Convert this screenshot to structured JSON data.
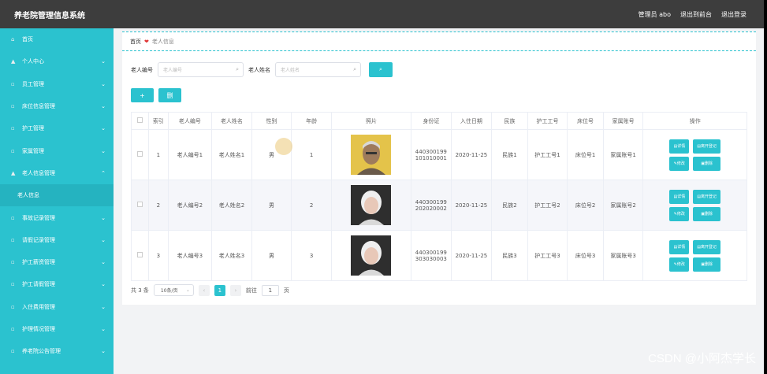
{
  "app": {
    "title": "养老院管理信息系统"
  },
  "topbar": {
    "admin": "管理员 abo",
    "back": "退出到前台",
    "logout": "退出登录"
  },
  "sidebar": {
    "items": [
      {
        "label": "首页",
        "arrow": ""
      },
      {
        "label": "个人中心",
        "arrow": "⌄"
      },
      {
        "label": "员工管理",
        "arrow": "⌄"
      },
      {
        "label": "床位信息管理",
        "arrow": "⌄"
      },
      {
        "label": "护工管理",
        "arrow": "⌄"
      },
      {
        "label": "家属管理",
        "arrow": "⌄"
      },
      {
        "label": "老人信息管理",
        "arrow": "⌃"
      },
      {
        "label": "老人信息",
        "arrow": ""
      },
      {
        "label": "事故记录管理",
        "arrow": "⌄"
      },
      {
        "label": "请假记录管理",
        "arrow": "⌄"
      },
      {
        "label": "护工薪资管理",
        "arrow": "⌄"
      },
      {
        "label": "护工请假管理",
        "arrow": "⌄"
      },
      {
        "label": "入住费用管理",
        "arrow": "⌄"
      },
      {
        "label": "护理情况管理",
        "arrow": "⌄"
      },
      {
        "label": "养老院公告管理",
        "arrow": "⌄"
      }
    ]
  },
  "breadcrumb": {
    "home": "首页",
    "heart": "❤",
    "current": "老人信息"
  },
  "search": {
    "id_label": "老人编号",
    "id_placeholder": "老人编号",
    "name_label": "老人姓名",
    "name_placeholder": "老人姓名"
  },
  "ops": {
    "add": "+",
    "delete": "删"
  },
  "table": {
    "headers": [
      "索引",
      "老人编号",
      "老人姓名",
      "性别",
      "年龄",
      "照片",
      "身份证",
      "入住日期",
      "民族",
      "护工工号",
      "床位号",
      "家属账号",
      "操作"
    ],
    "rows": [
      {
        "index": "1",
        "code": "老人编号1",
        "name": "老人姓名1",
        "gender": "男",
        "age": "1",
        "id1": "440300199",
        "id2": "101010001",
        "date": "2020-11-25",
        "nation": "民族1",
        "worker": "护工工号1",
        "bed": "床位号1",
        "family": "家属账号1"
      },
      {
        "index": "2",
        "code": "老人编号2",
        "name": "老人姓名2",
        "gender": "男",
        "age": "2",
        "id1": "440300199",
        "id2": "202020002",
        "date": "2020-11-25",
        "nation": "民族2",
        "worker": "护工工号2",
        "bed": "床位号2",
        "family": "家属账号2"
      },
      {
        "index": "3",
        "code": "老人编号3",
        "name": "老人姓名3",
        "gender": "男",
        "age": "3",
        "id1": "440300199",
        "id2": "303030003",
        "date": "2020-11-25",
        "nation": "民族3",
        "worker": "护工工号3",
        "bed": "床位号3",
        "family": "家属账号3"
      }
    ],
    "actions": {
      "detail": "详情",
      "register": "离开登记",
      "edit": "修改",
      "remove": "删除"
    }
  },
  "pager": {
    "total": "共 3 条",
    "size": "10条/页",
    "prev": "‹",
    "page": "1",
    "next": "›",
    "goto": "前往",
    "jump_val": "1",
    "unit": "页"
  },
  "watermark": "CSDN @小阿杰学长",
  "colors": {
    "accent": "#2bc2cf",
    "topbar": "#3d3d3d"
  }
}
